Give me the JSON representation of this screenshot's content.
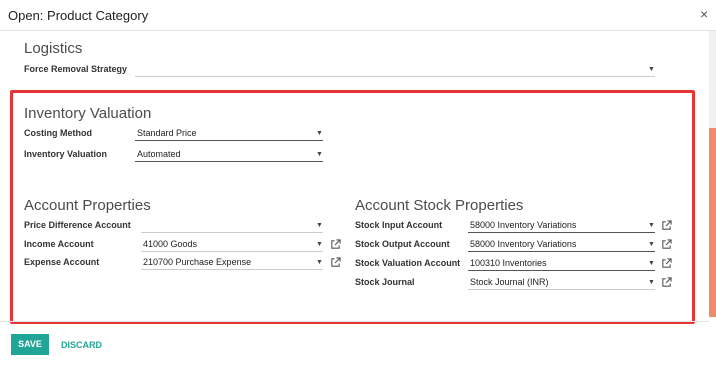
{
  "dialog": {
    "title": "Open: Product Category",
    "close_icon": "×"
  },
  "logistics": {
    "heading": "Logistics",
    "force_removal_strategy": {
      "label": "Force Removal Strategy",
      "value": ""
    }
  },
  "inventory_valuation": {
    "heading": "Inventory Valuation",
    "costing_method": {
      "label": "Costing Method",
      "value": "Standard Price"
    },
    "valuation": {
      "label": "Inventory Valuation",
      "value": "Automated"
    }
  },
  "account_properties": {
    "heading": "Account Properties",
    "price_difference": {
      "label": "Price Difference Account",
      "value": ""
    },
    "income": {
      "label": "Income Account",
      "value": "41000 Goods"
    },
    "expense": {
      "label": "Expense Account",
      "value": "210700 Purchase Expense"
    }
  },
  "account_stock_properties": {
    "heading": "Account Stock Properties",
    "stock_input": {
      "label": "Stock Input Account",
      "value": "58000 Inventory Variations"
    },
    "stock_output": {
      "label": "Stock Output Account",
      "value": "58000 Inventory Variations"
    },
    "stock_valuation": {
      "label": "Stock Valuation Account",
      "value": "100310 Inventories"
    },
    "stock_journal": {
      "label": "Stock Journal",
      "value": "Stock Journal (INR)"
    }
  },
  "footer": {
    "save_label": "SAVE",
    "discard_label": "DISCARD"
  },
  "colors": {
    "accent": "#21a596",
    "highlight": "#e83434",
    "scrollbar": "#f08a68"
  }
}
